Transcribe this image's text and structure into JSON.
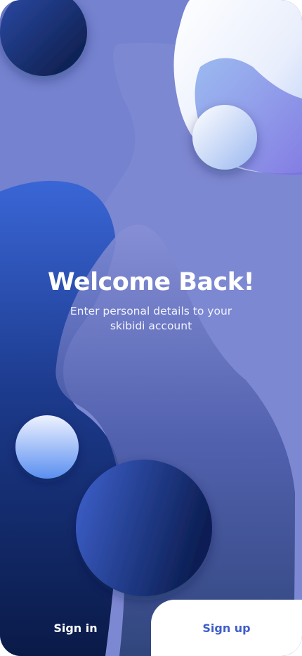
{
  "welcome": {
    "title": "Welcome Back!",
    "subtitle": "Enter personal details to your skibidi account"
  },
  "tabs": {
    "sign_in": "Sign in",
    "sign_up": "Sign up",
    "active": "sign_up"
  },
  "colors": {
    "background": "#7482cf",
    "deep_blue": "#0b1c4d",
    "accent_text": "#3e5ec9",
    "light_orb": "#dfe8ff"
  }
}
